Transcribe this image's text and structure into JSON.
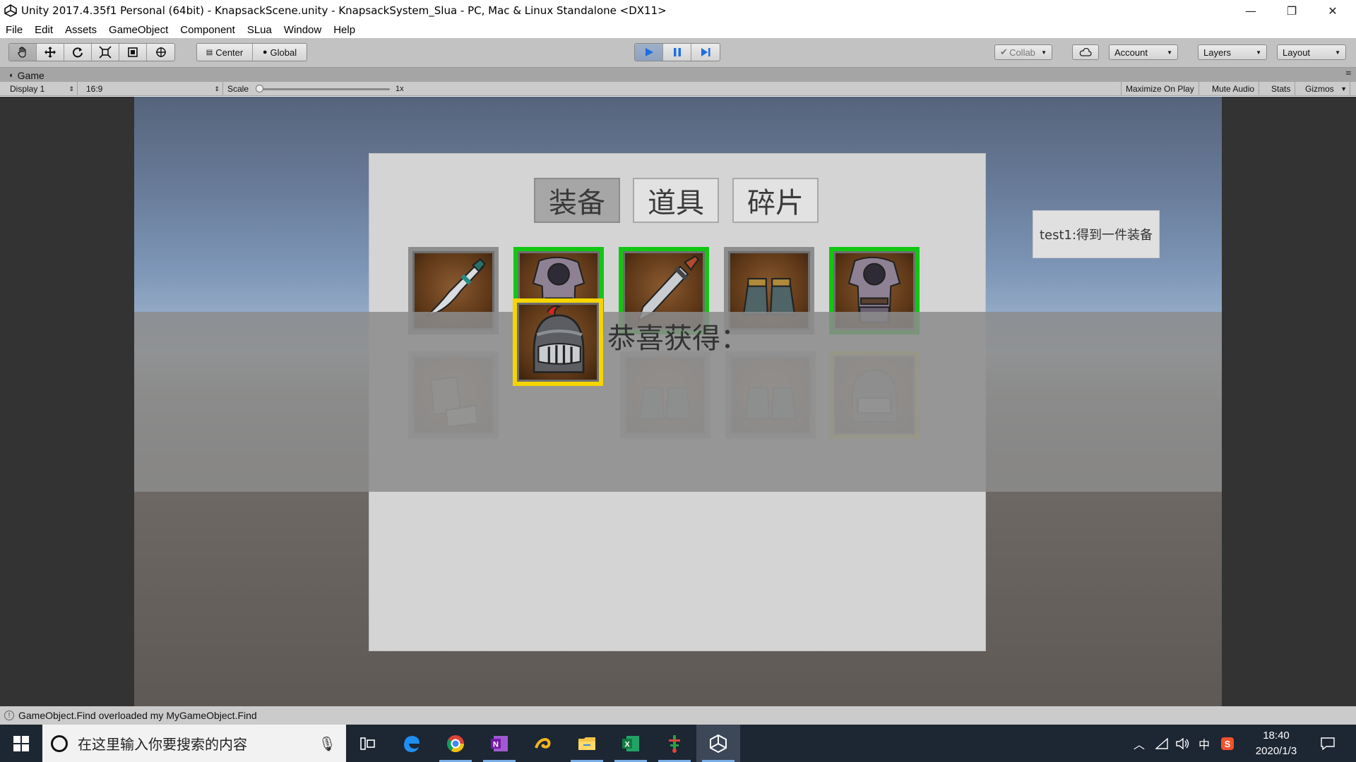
{
  "window": {
    "title": "Unity 2017.4.35f1 Personal (64bit) - KnapsackScene.unity - KnapsackSystem_Slua - PC, Mac & Linux Standalone <DX11>",
    "minimize": "—",
    "restore": "❐",
    "close": "✕"
  },
  "menu": [
    "File",
    "Edit",
    "Assets",
    "GameObject",
    "Component",
    "SLua",
    "Window",
    "Help"
  ],
  "toolbar": {
    "tools": [
      "hand-icon",
      "move-icon",
      "rotate-icon",
      "scale-icon",
      "rect-icon",
      "transform-icon"
    ],
    "pivot_center": "Center",
    "pivot_global": "Global",
    "collab": "Collab",
    "account": "Account",
    "layers": "Layers",
    "layout": "Layout"
  },
  "game_tab": {
    "label": "Game",
    "display": "Display 1",
    "aspect": "16:9",
    "scale_label": "Scale",
    "scale_value": "1x",
    "maximize_on_play": "Maximize On Play",
    "mute_audio": "Mute Audio",
    "stats": "Stats",
    "gizmos": "Gizmos"
  },
  "game": {
    "tabs": [
      {
        "label": "装备",
        "selected": true
      },
      {
        "label": "道具",
        "selected": false
      },
      {
        "label": "碎片",
        "selected": false
      }
    ],
    "row1": [
      {
        "item": "dagger",
        "border": "gray"
      },
      {
        "item": "armor",
        "border": "green"
      },
      {
        "item": "sword",
        "border": "green"
      },
      {
        "item": "boots",
        "border": "gray"
      },
      {
        "item": "armor",
        "border": "green"
      }
    ],
    "row2": [
      {
        "item": "gloves",
        "border": "gray"
      },
      {
        "item": "helmet",
        "border": "yellow"
      },
      {
        "item": "boots",
        "border": "gray"
      },
      {
        "item": "boots",
        "border": "gray"
      },
      {
        "item": "helmet",
        "border": "yellow"
      }
    ],
    "overlay_text": "恭喜获得：",
    "message": "test1:得到一件装备"
  },
  "status": {
    "message": "GameObject.Find overloaded my MyGameObject.Find"
  },
  "taskbar": {
    "search_placeholder": "在这里输入你要搜索的内容",
    "apps": [
      "task-view-icon",
      "edge-icon",
      "chrome-icon",
      "onenote-icon",
      "app-swirl-icon",
      "file-explorer-icon",
      "excel-icon",
      "app-tree-icon",
      "unity-icon"
    ],
    "ime": "中",
    "time": "18:40",
    "date": "2020/1/3"
  }
}
